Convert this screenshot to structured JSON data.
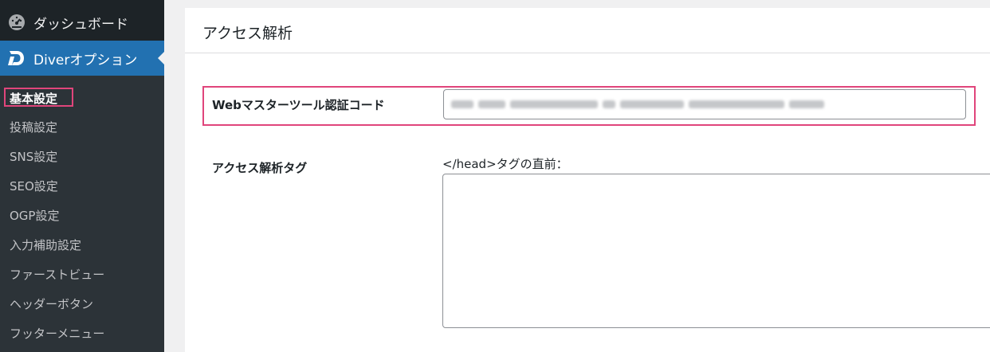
{
  "sidebar": {
    "dashboard_label": "ダッシュボード",
    "diver_label": "Diverオプション",
    "items": [
      {
        "label": "基本設定",
        "active": true
      },
      {
        "label": "投稿設定"
      },
      {
        "label": "SNS設定"
      },
      {
        "label": "SEO設定"
      },
      {
        "label": "OGP設定"
      },
      {
        "label": "入力補助設定"
      },
      {
        "label": "ファーストビュー"
      },
      {
        "label": "ヘッダーボタン"
      },
      {
        "label": "フッターメニュー"
      }
    ]
  },
  "main": {
    "title": "アクセス解析",
    "webmaster": {
      "label": "Webマスターツール認証コード"
    },
    "access_tag": {
      "label": "アクセス解析タグ",
      "head_label": "</head>タグの直前："
    }
  },
  "colors": {
    "sidebar_bg": "#1d2327",
    "submenu_bg": "#2c3338",
    "accent": "#2271b1",
    "highlight": "#e0457b"
  },
  "icons": {
    "dashboard": "dashboard-gauge-icon",
    "diver": "diver-logo-icon"
  }
}
